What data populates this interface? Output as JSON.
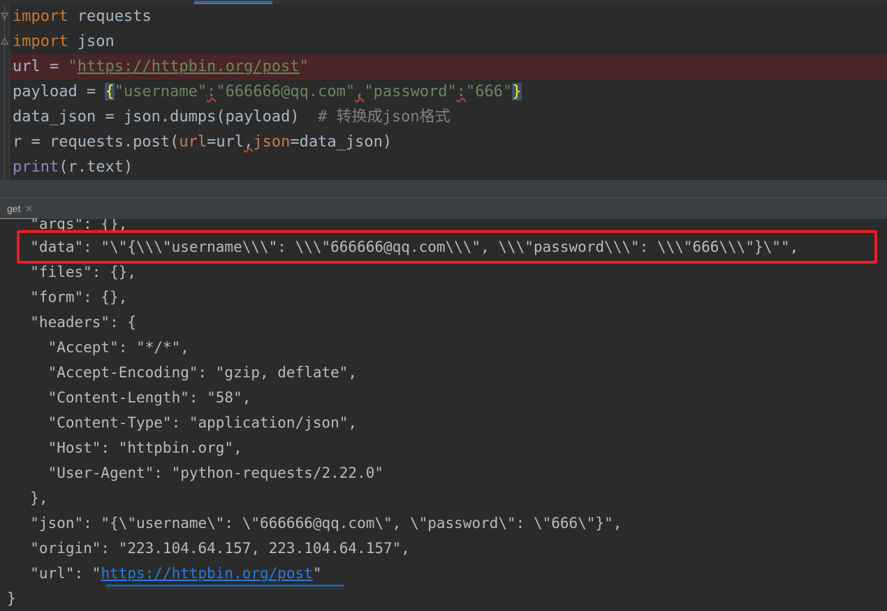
{
  "app": {
    "theme": "darcula",
    "accent_blue": "#4a7ab0",
    "annotation_color": "#ec1c24",
    "editor_bg": "#2b2b2b",
    "gutter_bg": "#313335",
    "error_line_bg": "#4a2527"
  },
  "editor": {
    "gutter": {
      "fold_icons": [
        "fold-collapse-icon",
        "fold-collapse-icon"
      ]
    },
    "lines": [
      {
        "id": "line-import-requests",
        "tokens": [
          {
            "type": "kw",
            "text": "import"
          },
          {
            "type": "plain",
            "text": " requests"
          }
        ]
      },
      {
        "id": "line-import-json",
        "tokens": [
          {
            "type": "kw",
            "text": "import"
          },
          {
            "type": "plain",
            "text": " json"
          }
        ]
      },
      {
        "id": "line-url",
        "error_background": true,
        "tokens": [
          {
            "type": "plain",
            "text": "url = "
          },
          {
            "type": "str",
            "text": "\""
          },
          {
            "type": "link",
            "text": "https://httpbin.org/post"
          },
          {
            "type": "str",
            "text": "\""
          }
        ]
      },
      {
        "id": "line-payload",
        "tokens": [
          {
            "type": "plain",
            "text": "payload = "
          },
          {
            "type": "brace",
            "text": "{"
          },
          {
            "type": "str",
            "text": "\"username\""
          },
          {
            "type": "str-err",
            "text": ":"
          },
          {
            "type": "str",
            "text": "\"666666@qq.com\""
          },
          {
            "type": "str-err",
            "text": ","
          },
          {
            "type": "str",
            "text": "\"password\""
          },
          {
            "type": "str-err",
            "text": ":"
          },
          {
            "type": "str",
            "text": "\"666\""
          },
          {
            "type": "brace",
            "text": "}"
          }
        ]
      },
      {
        "id": "line-data-json",
        "tokens": [
          {
            "type": "plain",
            "text": "data_json = json.dumps(payload)  "
          },
          {
            "type": "comment",
            "text": "# 转换成json格式"
          }
        ]
      },
      {
        "id": "line-post",
        "tokens": [
          {
            "type": "plain",
            "text": "r = requests.post("
          },
          {
            "type": "param",
            "text": "url"
          },
          {
            "type": "plain",
            "text": "=url"
          },
          {
            "type": "plain-err",
            "text": ","
          },
          {
            "type": "param",
            "text": "json"
          },
          {
            "type": "plain",
            "text": "=data_json)"
          }
        ]
      },
      {
        "id": "line-print",
        "tokens": [
          {
            "type": "builtin",
            "text": "print"
          },
          {
            "type": "plain",
            "text": "(r.text)"
          }
        ]
      }
    ]
  },
  "console": {
    "tab": {
      "label": "get",
      "close_icon": "close-icon"
    },
    "output_lines": [
      {
        "id": "out-args",
        "text": "  \"args\": {},"
      },
      {
        "id": "out-data",
        "text": "  \"data\": \"\\\"{\\\\\\\"username\\\\\\\": \\\\\\\"666666@qq.com\\\\\\\", \\\\\\\"password\\\\\\\": \\\\\\\"666\\\\\\\"}\\\"\","
      },
      {
        "id": "out-files",
        "text": "  \"files\": {},"
      },
      {
        "id": "out-form",
        "text": "  \"form\": {},"
      },
      {
        "id": "out-headers",
        "text": "  \"headers\": {"
      },
      {
        "id": "out-accept",
        "text": "    \"Accept\": \"*/*\","
      },
      {
        "id": "out-accept-encoding",
        "text": "    \"Accept-Encoding\": \"gzip, deflate\","
      },
      {
        "id": "out-content-length",
        "text": "    \"Content-Length\": \"58\","
      },
      {
        "id": "out-content-type",
        "text": "    \"Content-Type\": \"application/json\","
      },
      {
        "id": "out-host",
        "text": "    \"Host\": \"httpbin.org\","
      },
      {
        "id": "out-user-agent",
        "text": "    \"User-Agent\": \"python-requests/2.22.0\""
      },
      {
        "id": "out-headers-close",
        "text": "  },"
      },
      {
        "id": "out-json",
        "text": "  \"json\": \"{\\\"username\\\": \\\"666666@qq.com\\\", \\\"password\\\": \\\"666\\\"}\","
      },
      {
        "id": "out-origin",
        "text": "  \"origin\": \"223.104.64.157, 223.104.64.157\","
      },
      {
        "id": "out-url-prefix",
        "text": "  \"url\": \""
      },
      {
        "id": "out-url-link",
        "text": "https://httpbin.org/post"
      },
      {
        "id": "out-url-suffix",
        "text": "\""
      },
      {
        "id": "out-close-brace",
        "text": "}"
      }
    ]
  },
  "annotation": {
    "name": "red-highlight-box",
    "targets": "data field line"
  }
}
